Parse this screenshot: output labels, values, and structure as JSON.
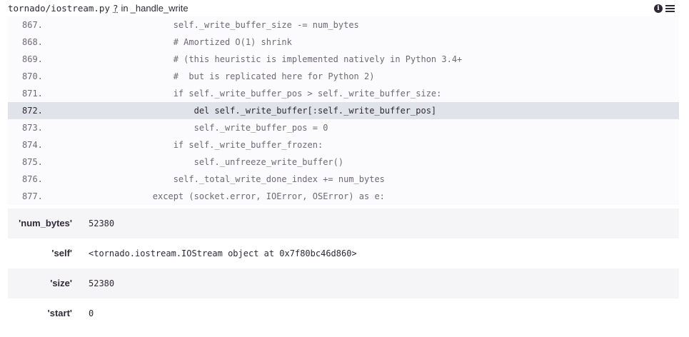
{
  "frame": {
    "file": "tornado/iostream.py",
    "qmark": "?",
    "in_word": "in",
    "function": "_handle_write"
  },
  "icons": [
    "info-icon",
    "list-icon"
  ],
  "code": [
    {
      "no": "867.",
      "code": "            self._write_buffer_size -= num_bytes",
      "active": false
    },
    {
      "no": "868.",
      "code": "            # Amortized O(1) shrink",
      "active": false
    },
    {
      "no": "869.",
      "code": "            # (this heuristic is implemented natively in Python 3.4+",
      "active": false
    },
    {
      "no": "870.",
      "code": "            #  but is replicated here for Python 2)",
      "active": false
    },
    {
      "no": "871.",
      "code": "            if self._write_buffer_pos > self._write_buffer_size:",
      "active": false
    },
    {
      "no": "872.",
      "code": "                del self._write_buffer[:self._write_buffer_pos]",
      "active": true
    },
    {
      "no": "873.",
      "code": "                self._write_buffer_pos = 0",
      "active": false
    },
    {
      "no": "874.",
      "code": "            if self._write_buffer_frozen:",
      "active": false
    },
    {
      "no": "875.",
      "code": "                self._unfreeze_write_buffer()",
      "active": false
    },
    {
      "no": "876.",
      "code": "            self._total_write_done_index += num_bytes",
      "active": false
    },
    {
      "no": "877.",
      "code": "        except (socket.error, IOError, OSError) as e:",
      "active": false
    }
  ],
  "variables": [
    {
      "name": "'num_bytes'",
      "value": "52380"
    },
    {
      "name": "'self'",
      "value": "<tornado.iostream.IOStream object at 0x7f80bc46d860>"
    },
    {
      "name": "'size'",
      "value": "52380"
    },
    {
      "name": "'start'",
      "value": "0"
    }
  ]
}
